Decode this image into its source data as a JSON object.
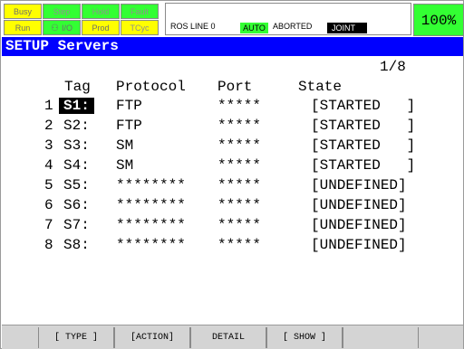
{
  "status": {
    "busy": "Busy",
    "step": "Step",
    "hold": "Hold",
    "fault": "Fault",
    "run": "Run",
    "io": "I/O",
    "prod": "Prod",
    "tcyc": "TCyc",
    "message_line": "ROS LINE 0",
    "mode": "AUTO",
    "prog_state": "ABORTED",
    "coord": "JOINT",
    "override": "100%"
  },
  "screen": {
    "title": "SETUP Servers",
    "page": "1/8"
  },
  "table": {
    "headers": {
      "tag": "Tag",
      "protocol": "Protocol",
      "port": "Port",
      "state": "State"
    },
    "rows": [
      {
        "num": "1",
        "tag": "S1:",
        "protocol": "FTP",
        "port": "*****",
        "state": "[STARTED   ]"
      },
      {
        "num": "2",
        "tag": "S2:",
        "protocol": "FTP",
        "port": "*****",
        "state": "[STARTED   ]"
      },
      {
        "num": "3",
        "tag": "S3:",
        "protocol": "SM",
        "port": "*****",
        "state": "[STARTED   ]"
      },
      {
        "num": "4",
        "tag": "S4:",
        "protocol": "SM",
        "port": "*****",
        "state": "[STARTED   ]"
      },
      {
        "num": "5",
        "tag": "S5:",
        "protocol": "********",
        "port": "*****",
        "state": "[UNDEFINED]"
      },
      {
        "num": "6",
        "tag": "S6:",
        "protocol": "********",
        "port": "*****",
        "state": "[UNDEFINED]"
      },
      {
        "num": "7",
        "tag": "S7:",
        "protocol": "********",
        "port": "*****",
        "state": "[UNDEFINED]"
      },
      {
        "num": "8",
        "tag": "S8:",
        "protocol": "********",
        "port": "*****",
        "state": "[UNDEFINED]"
      }
    ]
  },
  "fkeys": {
    "f1": "[ TYPE ]",
    "f2": "[ACTION]",
    "f3": "DETAIL",
    "f4": "[ SHOW ]",
    "f5": ""
  },
  "colors": {
    "title_bg": "#0000ff",
    "indicator_yellow": "#ffff00",
    "indicator_green": "#33ff33"
  }
}
